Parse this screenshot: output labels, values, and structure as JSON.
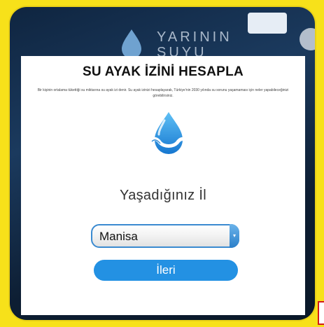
{
  "background": {
    "title_line1": "YARININ",
    "title_line2": "SUYU",
    "accent_yellow": "#f7e11a",
    "dark_blue": "#0f2540"
  },
  "modal": {
    "title": "SU AYAK İZİNİ HESAPLA",
    "description": "Bir kişinin ortalama tükettiği su miktarına su ayak izi denir. Su ayak izinizi hesaplayarak, Türkiye'nin 2030 yılında su sorunu yaşamaması için neler yapabileceğinizi görebilirsiniz.",
    "field_label": "Yaşadığınız İl",
    "select_value": "Manisa",
    "next_label": "İleri",
    "brand_blue": "#2391e3",
    "icon": "water-drop-hug-icon"
  }
}
